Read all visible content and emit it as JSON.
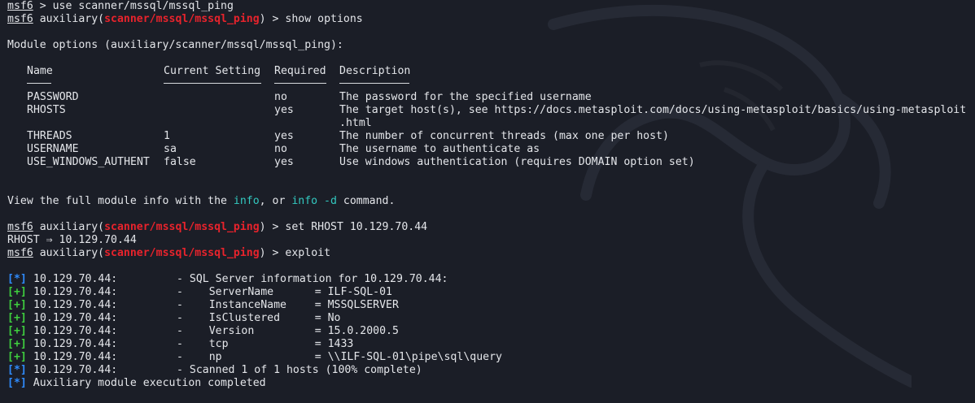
{
  "lines": {
    "l1_prompt": "msf6",
    "l1_cmd": " > use scanner/mssql/mssql_ping",
    "l2_prompt": "msf6",
    "l2_aux_open": " auxiliary(",
    "l2_module": "scanner/mssql/mssql_ping",
    "l2_aux_close": ") > show options",
    "module_options": "Module options (auxiliary/scanner/mssql/mssql_ping):",
    "view_pre": "View the full module info with the ",
    "view_info": "info",
    "view_mid": ", or ",
    "view_info_d": "info -d",
    "view_post": " command.",
    "l_set_prompt": "msf6",
    "l_set_aux_open": " auxiliary(",
    "l_set_module": "scanner/mssql/mssql_ping",
    "l_set_cmd": ") > set RHOST 10.129.70.44",
    "rhost_echo": "RHOST ⇒ 10.129.70.44",
    "l_exp_prompt": "msf6",
    "l_exp_aux_open": " auxiliary(",
    "l_exp_module": "scanner/mssql/mssql_ping",
    "l_exp_cmd": ") > exploit"
  },
  "options_table": {
    "headers": [
      "Name",
      "Current Setting",
      "Required",
      "Description"
    ],
    "rows": [
      [
        "PASSWORD",
        "",
        "no",
        "The password for the specified username"
      ],
      [
        "RHOSTS",
        "",
        "yes",
        "The target host(s), see https://docs.metasploit.com/docs/using-metasploit/basics/using-metasploit"
      ],
      [
        "",
        "",
        "",
        ".html"
      ],
      [
        "THREADS",
        "1",
        "yes",
        "The number of concurrent threads (max one per host)"
      ],
      [
        "USERNAME",
        "sa",
        "no",
        "The username to authenticate as"
      ],
      [
        "USE_WINDOWS_AUTHENT",
        "false",
        "yes",
        "Use windows authentication (requires DOMAIN option set)"
      ]
    ]
  },
  "results": [
    {
      "tag": "[*]",
      "host": "10.129.70.44:",
      "msg": "- SQL Server information for 10.129.70.44:"
    },
    {
      "tag": "[+]",
      "host": "10.129.70.44:",
      "msg": "-    ",
      "key": "ServerName",
      "val": "= ILF-SQL-01"
    },
    {
      "tag": "[+]",
      "host": "10.129.70.44:",
      "msg": "-    ",
      "key": "InstanceName",
      "val": "= MSSQLSERVER"
    },
    {
      "tag": "[+]",
      "host": "10.129.70.44:",
      "msg": "-    ",
      "key": "IsClustered",
      "val": "= No"
    },
    {
      "tag": "[+]",
      "host": "10.129.70.44:",
      "msg": "-    ",
      "key": "Version",
      "val": "= 15.0.2000.5"
    },
    {
      "tag": "[+]",
      "host": "10.129.70.44:",
      "msg": "-    ",
      "key": "tcp",
      "val": "= 1433"
    },
    {
      "tag": "[+]",
      "host": "10.129.70.44:",
      "msg": "-    ",
      "key": "np",
      "val": "= \\\\ILF-SQL-01\\pipe\\sql\\query"
    },
    {
      "tag": "[*]",
      "host": "10.129.70.44:",
      "msg": "- Scanned 1 of 1 hosts (100% complete)"
    }
  ],
  "final": {
    "tag": "[*]",
    "text": "Auxiliary module execution completed"
  },
  "colors": {
    "background": "#1b1e27",
    "text": "#e4e6ea",
    "module_red": "#e8232c",
    "info_cyan": "#33c9c0",
    "status_blue": "#2f8cff",
    "status_green": "#3fcf3f"
  },
  "icons": {
    "background": "kali-dragon-watermark"
  }
}
